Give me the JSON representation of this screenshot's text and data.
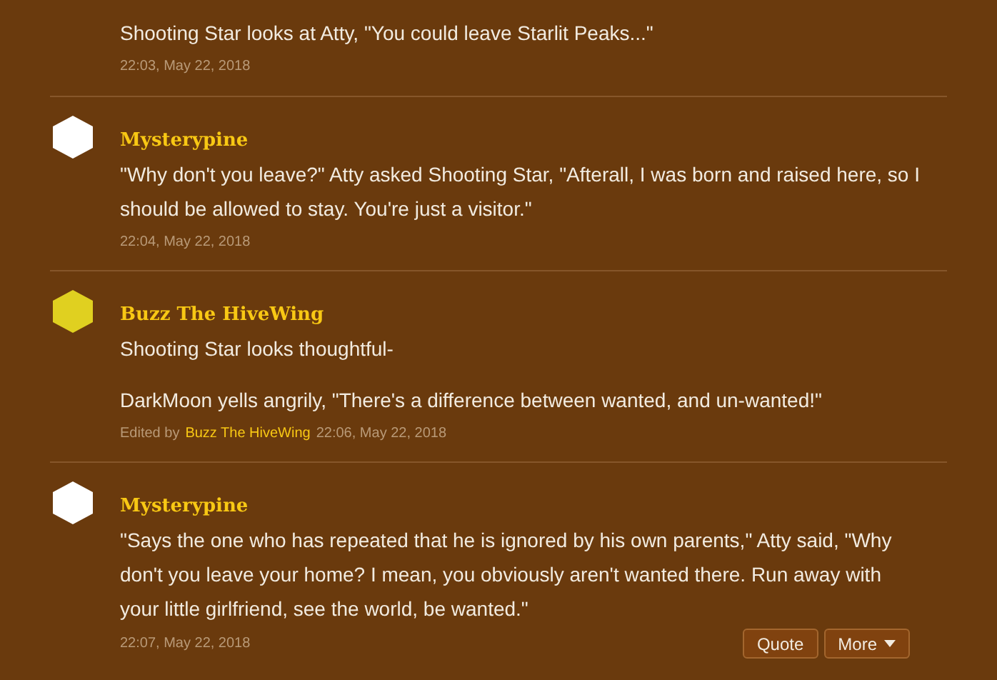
{
  "posts": [
    {
      "paragraphs": [
        "Shooting Star looks at Atty, \"You could leave Starlit Peaks...\""
      ],
      "time": "22:03, May 22, 2018"
    },
    {
      "author": "Mysterypine",
      "color": "#ffffff",
      "paragraphs": [
        "\"Why don't you leave?\" Atty asked Shooting Star, \"Afterall, I was born and raised here, so I should be allowed to stay. You're just a visitor.\""
      ],
      "time": "22:04, May 22, 2018"
    },
    {
      "author": "Buzz The HiveWing",
      "color": "#e0d020",
      "paragraphs": [
        "Shooting Star looks thoughtful-",
        "DarkMoon yells angrily, \"There's a difference between wanted, and un-wanted!\""
      ],
      "edited_label": "Edited by",
      "edited_by": "Buzz The HiveWing",
      "time": "22:06, May 22, 2018"
    },
    {
      "author": "Mysterypine",
      "color": "#ffffff",
      "paragraphs": [
        "\"Says the one who has repeated that he is ignored by his own parents,\" Atty said, \"Why don't you leave your home? I mean, you obviously aren't wanted there. Run away with your little girlfriend, see the world, be wanted.\""
      ],
      "time": "22:07, May 22, 2018",
      "actions": [
        {
          "label": "Quote",
          "kind": "plain"
        },
        {
          "label": "More",
          "kind": "menu"
        }
      ]
    }
  ]
}
